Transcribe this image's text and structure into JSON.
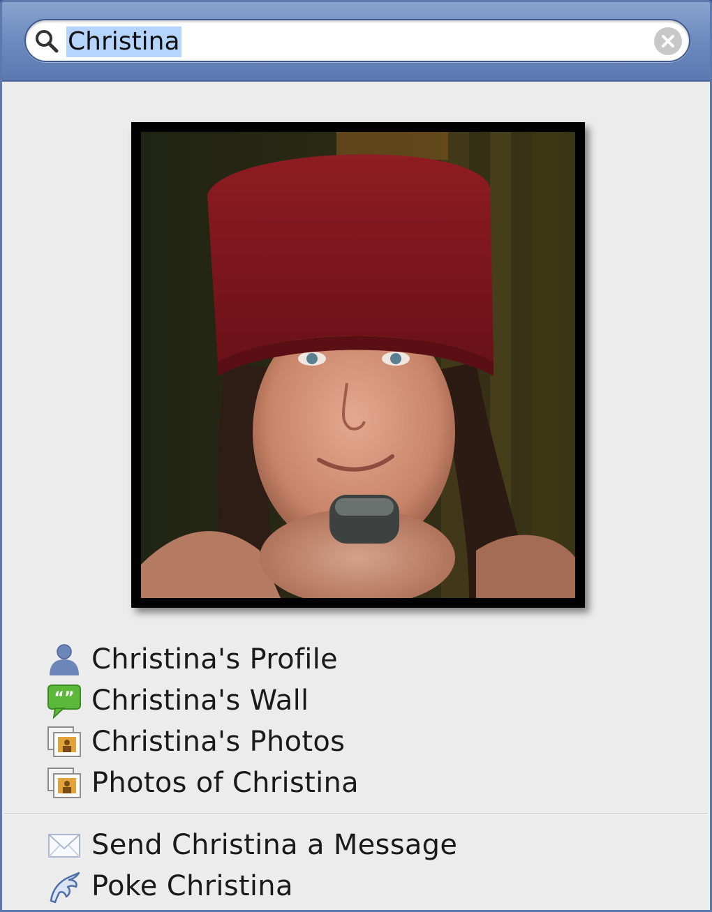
{
  "search": {
    "query": "Christina"
  },
  "profile_photo": {
    "alt": "Christina"
  },
  "menu": {
    "profile_label": "Christina's Profile",
    "wall_label": "Christina's Wall",
    "photos_label": "Christina's Photos",
    "photos_of_label": "Photos of Christina",
    "message_label": "Send Christina a Message",
    "poke_label": "Poke Christina"
  },
  "icons": {
    "search": "magnifier-icon",
    "clear": "clear-x-icon",
    "profile": "person-silhouette-icon",
    "wall": "speech-bubble-icon",
    "photos": "photo-stack-icon",
    "photos_of": "photo-stack-icon",
    "message": "envelope-icon",
    "poke": "poke-hand-icon"
  },
  "colors": {
    "header": "#6f8cc0",
    "border": "#5c78ad",
    "panel_bg": "#ececec",
    "selection": "#b5d5ff",
    "wall_icon": "#5cb83a"
  }
}
